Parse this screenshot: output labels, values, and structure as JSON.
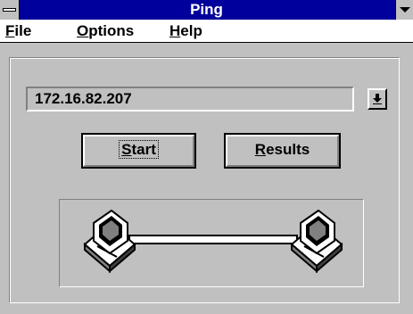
{
  "window": {
    "title": "Ping"
  },
  "menu": {
    "items": [
      {
        "accel": "F",
        "rest": "ile"
      },
      {
        "accel": "O",
        "rest": "ptions"
      },
      {
        "accel": "H",
        "rest": "elp"
      }
    ]
  },
  "host": {
    "value": "172.16.82.207"
  },
  "buttons": {
    "start": {
      "accel": "S",
      "rest": "tart"
    },
    "results": {
      "accel": "R",
      "rest": "esults"
    }
  },
  "icons": {
    "system_menu": "system-menu-icon",
    "minimize": "minimize-icon",
    "dropdown": "dropdown-arrow-icon",
    "computer_left": "computer-icon",
    "computer_right": "computer-icon"
  },
  "colors": {
    "titlebar": "#00009c",
    "face": "#c0c0c0"
  }
}
